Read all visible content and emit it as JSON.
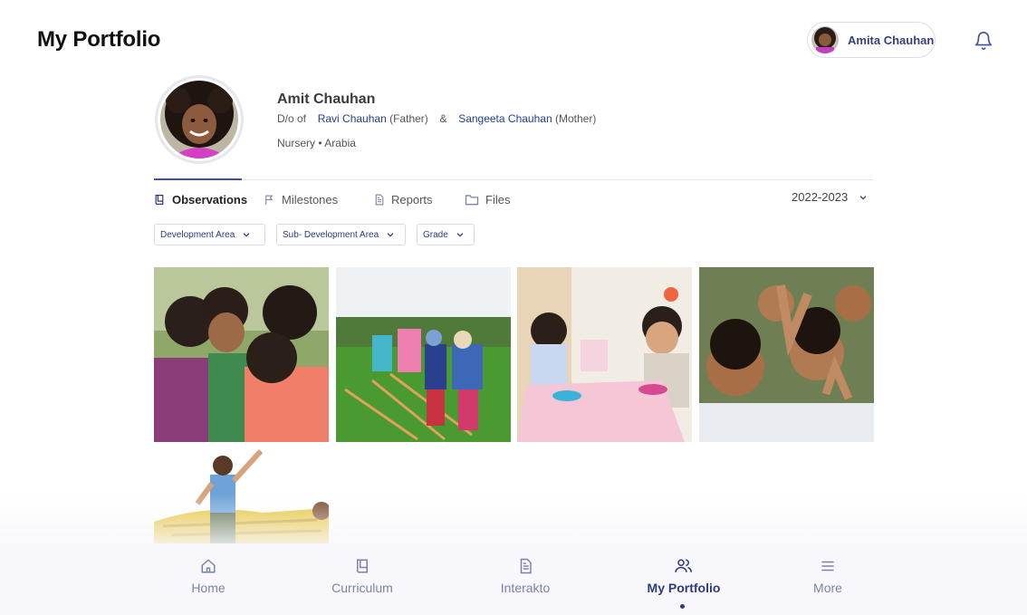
{
  "header": {
    "title": "My Portfolio",
    "user_name": "Amita Chauhan",
    "bell_icon": "bell-icon"
  },
  "profile": {
    "name": "Amit Chauhan",
    "relation_prefix": "D/o of",
    "father_name": "Ravi Chauhan",
    "father_role": "(Father)",
    "connector": "&",
    "mother_name": "Sangeeta Chauhan",
    "mother_role": "(Mother)",
    "class": "Nursery",
    "separator": "•",
    "branch": "Arabia"
  },
  "tabs": [
    {
      "label": "Observations",
      "icon": "book-icon",
      "active": true
    },
    {
      "label": "Milestones",
      "icon": "flag-icon",
      "active": false
    },
    {
      "label": "Reports",
      "icon": "document-icon",
      "active": false
    },
    {
      "label": "Files",
      "icon": "folder-icon",
      "active": false
    }
  ],
  "year": {
    "selected": "2022-2023"
  },
  "filters": [
    {
      "label": "Development Area"
    },
    {
      "label": "Sub- Development Area"
    },
    {
      "label": "Grade"
    }
  ],
  "photos": [
    {
      "name": "children-hugging-photo"
    },
    {
      "name": "kids-playing-on-field-photo"
    },
    {
      "name": "kids-at-classroom-table-photo"
    },
    {
      "name": "smiling-children-group-photo"
    },
    {
      "name": "boy-on-bouncy-castle-photo"
    }
  ],
  "bottom_nav": [
    {
      "label": "Home",
      "icon": "home-icon",
      "active": false
    },
    {
      "label": "Curriculum",
      "icon": "book-icon",
      "active": false
    },
    {
      "label": "Interakto",
      "icon": "document-icon",
      "active": false
    },
    {
      "label": "My Portfolio",
      "icon": "users-icon",
      "active": true
    },
    {
      "label": "More",
      "icon": "menu-icon",
      "active": false
    }
  ],
  "colors": {
    "accent": "#2e3a7f",
    "link": "#1f3f8f",
    "nav_inactive": "#7a82ab",
    "nav_background": "#f8f8fc"
  }
}
